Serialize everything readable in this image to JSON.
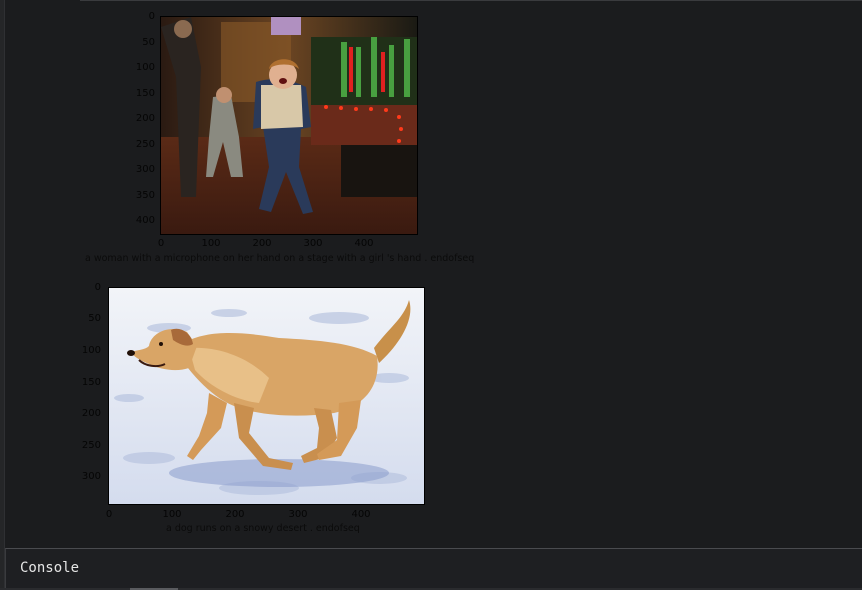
{
  "figures": [
    {
      "yticks": [
        "0",
        "50",
        "100",
        "150",
        "200",
        "250",
        "300",
        "350",
        "400"
      ],
      "xticks": [
        "0",
        "100",
        "200",
        "300",
        "400"
      ],
      "caption": "a woman with a microphone on her hand on a stage with a girl 's hand . endofseq"
    },
    {
      "yticks": [
        "0",
        "50",
        "100",
        "150",
        "200",
        "250",
        "300"
      ],
      "xticks": [
        "0",
        "100",
        "200",
        "300",
        "400"
      ],
      "caption": "a dog runs on a snowy desert . endofseq"
    }
  ],
  "console": {
    "label": "Console"
  },
  "colors": {
    "background": "#1b1c1e",
    "console_text": "#e6e6e6"
  }
}
